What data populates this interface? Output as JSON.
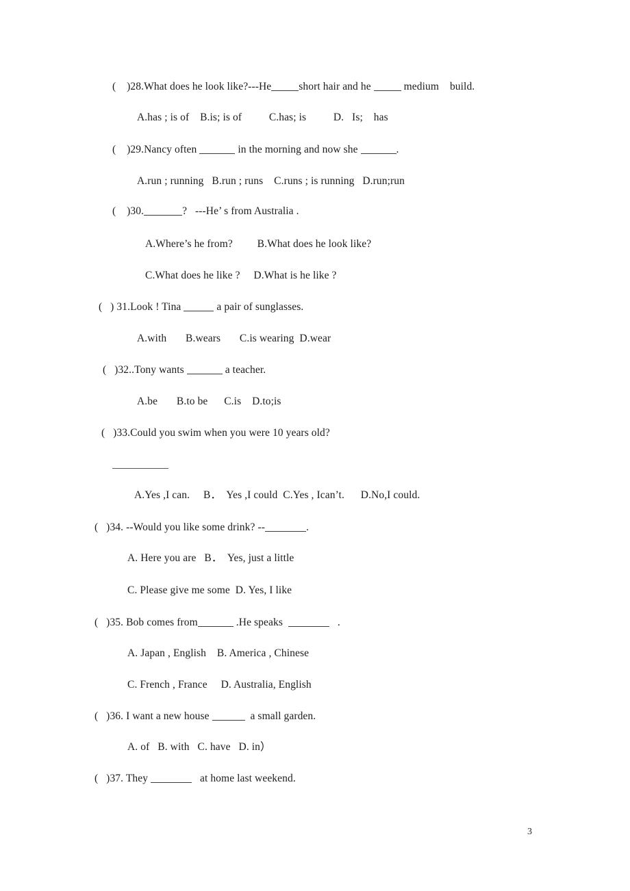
{
  "document": {
    "page_number": "3",
    "type": "english-exam-multiple-choice"
  },
  "questions": [
    {
      "marker": "(    )28.",
      "stem_parts": [
        "What does he look like?---He",
        "short hair and he",
        "medium    build."
      ],
      "blank_widths": [
        40,
        40
      ],
      "options_lines": [
        "A.has ; is of    B.is; is of          C.has; is          D.   Is;    has"
      ]
    },
    {
      "marker": "(    )29.",
      "stem_parts": [
        "Nancy often ",
        " in the morning and now she ",
        "."
      ],
      "blank_widths": [
        52,
        52
      ],
      "options_lines": [
        "A.run ; running   B.run ; runs    C.runs ; is running   D.run;run"
      ]
    },
    {
      "marker": "(    )30.",
      "stem_parts": [
        "",
        "?   ---He’ s from Australia ."
      ],
      "blank_widths": [
        56
      ],
      "options_lines": [
        "A.Where’s he from?         B.What does he look like?",
        "C.What does he like ?     D.What is he like ?"
      ]
    },
    {
      "marker": "(   ) 31.",
      "stem_parts": [
        "Look ! Tina ",
        " a pair of sunglasses."
      ],
      "blank_widths": [
        44
      ],
      "options_lines": [
        "A.with       B.wears       C.is wearing  D.wear"
      ]
    },
    {
      "marker": "(   )32.",
      "stem_parts": [
        ".Tony wants ",
        " a teacher."
      ],
      "blank_widths": [
        52
      ],
      "options_lines": [
        "A.be       B.to be      C.is    D.to;is"
      ]
    },
    {
      "marker": "(   )33.",
      "stem_parts": [
        "Could you swim when you were 10 years old?"
      ],
      "blank_widths": [],
      "standalone_rule": true,
      "options_lines": [
        "A.Yes ,I can.     B．  Yes ,I could  C.Yes , Ican’t.      D.No,I could."
      ]
    },
    {
      "marker": "(   )34.",
      "stem_parts": [
        " --Would you like some drink? --",
        "."
      ],
      "blank_widths": [
        60
      ],
      "options_lines": [
        "A. Here you are   B．  Yes, just a little",
        "C. Please give me some  D. Yes, I like"
      ]
    },
    {
      "marker": "(   )35.",
      "stem_parts": [
        " Bob comes from",
        " .He speaks  ",
        "   ."
      ],
      "blank_widths": [
        52,
        60
      ],
      "options_lines": [
        "A. Japan , English    B. America , Chinese",
        "C. French , France     D. Australia, English"
      ]
    },
    {
      "marker": "(   )36.",
      "stem_parts": [
        " I want a new house ",
        "  a small garden."
      ],
      "blank_widths": [
        48
      ],
      "options_lines": [
        "A. of   B. with   C. have   D. in）"
      ]
    },
    {
      "marker": "(   )37.",
      "stem_parts": [
        " They ",
        "   at home last weekend."
      ],
      "blank_widths": [
        60
      ],
      "options_lines": []
    }
  ],
  "lines": {
    "q28_stem_a": "(    )28.What does he look like?---He",
    "q28_stem_b": "short hair and he ",
    "q28_stem_c": " medium    build.",
    "q28_opts": "A.has ; is of    B.is; is of          C.has; is          D.   Is;    has",
    "q29_stem_a": "(    )29.Nancy often ",
    "q29_stem_b": " in the morning and now she ",
    "q29_stem_c": ".",
    "q29_opts": "A.run ; running   B.run ; runs    C.runs ; is running   D.run;run",
    "q30_stem_a": "(    )30.",
    "q30_stem_b": "?   ---He’ s from Australia .",
    "q30_opts_ab": "A.Where’s he from?         B.What does he look like?",
    "q30_opts_cd": "C.What does he like ?     D.What is he like ?",
    "q31_stem_a": "(   ) 31.Look ! Tina ",
    "q31_stem_b": " a pair of sunglasses.",
    "q31_opts": "A.with       B.wears       C.is wearing  D.wear",
    "q32_stem_a": "(   )32..Tony wants ",
    "q32_stem_b": " a teacher.",
    "q32_opts": "A.be       B.to be      C.is    D.to;is",
    "q33_stem": "(   )33.Could you swim when you were 10 years old?",
    "q33_opts": "A.Yes ,I can.     B．  Yes ,I could  C.Yes , Ican’t.      D.No,I could.",
    "q34_stem_a": "(   )34. --Would you like some drink? --",
    "q34_stem_b": ".",
    "q34_opts_ab": "A. Here you are   B．  Yes, just a little",
    "q34_opts_cd": "C. Please give me some  D. Yes, I like",
    "q35_stem_a": "(   )35. Bob comes from",
    "q35_stem_b": " .He speaks  ",
    "q35_stem_c": "   .",
    "q35_opts_ab": "A. Japan , English    B. America , Chinese",
    "q35_opts_cd": "C. French , France     D. Australia, English",
    "q36_stem_a": "(   )36. I want a new house ",
    "q36_stem_b": "  a small garden.",
    "q36_opts": "A. of   B. with   C. have   D. in）",
    "q37_stem_a": "(   )37. They ",
    "q37_stem_b": "   at home last weekend."
  }
}
